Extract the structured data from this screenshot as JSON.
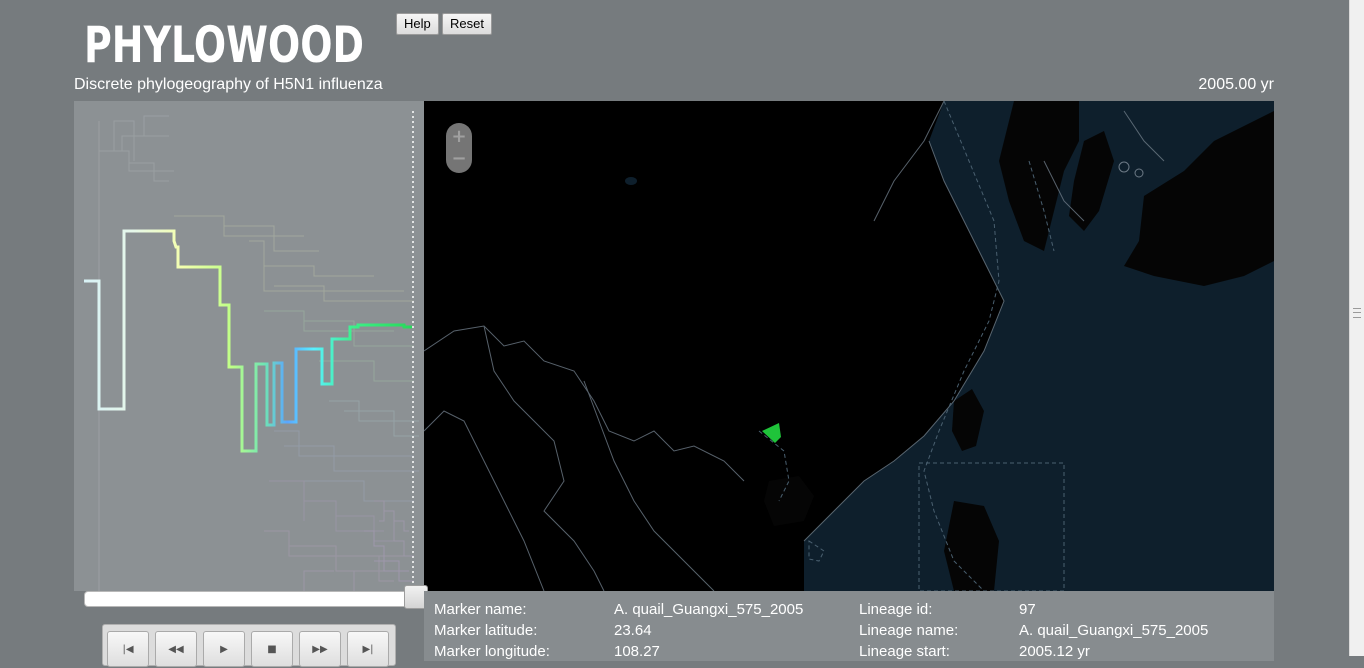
{
  "app": {
    "logo_text": "PHYLOWOOD",
    "subtitle": "Discrete phylogeography of H5N1 influenza",
    "current_time": "2005.00 yr"
  },
  "toolbar": {
    "help_label": "Help",
    "reset_label": "Reset"
  },
  "map": {
    "zoom_in_glyph": "+",
    "zoom_out_glyph": "−",
    "marker_color": "#1fc33a"
  },
  "timeline": {
    "slider_position_fraction": 1.0
  },
  "playback": {
    "buttons": [
      {
        "name": "skip-to-start",
        "glyph": "|◀"
      },
      {
        "name": "rewind",
        "glyph": "◀◀"
      },
      {
        "name": "play",
        "glyph": "▶"
      },
      {
        "name": "stop",
        "glyph": "■"
      },
      {
        "name": "fast-forward",
        "glyph": "▶▶"
      },
      {
        "name": "skip-to-end",
        "glyph": "▶|"
      }
    ]
  },
  "info": {
    "marker_name_label": "Marker name:",
    "marker_name_value": "A. quail_Guangxi_575_2005",
    "marker_latitude_label": "Marker latitude:",
    "marker_latitude_value": "23.64",
    "marker_longitude_label": "Marker longitude:",
    "marker_longitude_value": "108.27",
    "lineage_id_label": "Lineage id:",
    "lineage_id_value": "97",
    "lineage_name_label": "Lineage name:",
    "lineage_name_value": "A. quail_Guangxi_575_2005",
    "lineage_start_label": "Lineage start:",
    "lineage_start_value": "2005.12 yr"
  },
  "colors": {
    "page_bg": "#767b7e",
    "tree_bg": "#8c9194",
    "map_bg": "#000000",
    "sea": "#0e1f2c",
    "highlight_start": "#cfeff7",
    "highlight_mid": "#f1ffa5",
    "highlight_end": "#2fe86a"
  }
}
